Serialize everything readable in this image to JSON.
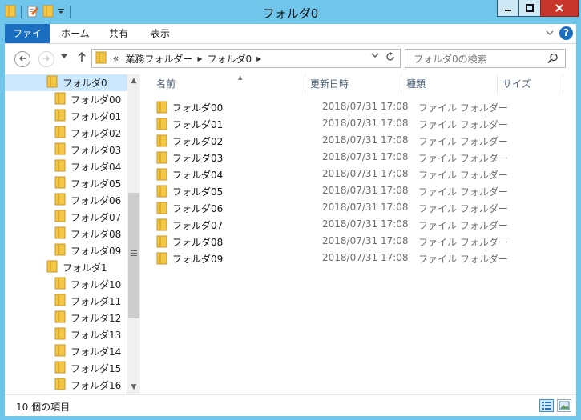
{
  "window": {
    "title": "フォルダ0",
    "colors": {
      "frame": "#6fc5ea",
      "accent": "#1a6fc1",
      "close": "#c7352b",
      "selection": "#cce8ff"
    }
  },
  "ribbon": {
    "tabs": [
      {
        "label": "ファイル"
      },
      {
        "label": "ホーム"
      },
      {
        "label": "共有"
      },
      {
        "label": "表示"
      }
    ]
  },
  "nav": {
    "breadcrumb": [
      "業務フォルダー",
      "フォルダ0"
    ],
    "overflow": "«"
  },
  "search": {
    "placeholder": "フォルダ0の検索"
  },
  "tree": {
    "items": [
      {
        "label": "フォルダ0",
        "level": 0,
        "selected": true
      },
      {
        "label": "フォルダ00",
        "level": 1
      },
      {
        "label": "フォルダ01",
        "level": 1
      },
      {
        "label": "フォルダ02",
        "level": 1
      },
      {
        "label": "フォルダ03",
        "level": 1
      },
      {
        "label": "フォルダ04",
        "level": 1
      },
      {
        "label": "フォルダ05",
        "level": 1
      },
      {
        "label": "フォルダ06",
        "level": 1
      },
      {
        "label": "フォルダ07",
        "level": 1
      },
      {
        "label": "フォルダ08",
        "level": 1
      },
      {
        "label": "フォルダ09",
        "level": 1
      },
      {
        "label": "フォルダ1",
        "level": 0
      },
      {
        "label": "フォルダ10",
        "level": 1
      },
      {
        "label": "フォルダ11",
        "level": 1
      },
      {
        "label": "フォルダ12",
        "level": 1
      },
      {
        "label": "フォルダ13",
        "level": 1
      },
      {
        "label": "フォルダ14",
        "level": 1
      },
      {
        "label": "フォルダ15",
        "level": 1
      },
      {
        "label": "フォルダ16",
        "level": 1
      }
    ]
  },
  "list": {
    "columns": [
      {
        "label": "名前"
      },
      {
        "label": "更新日時"
      },
      {
        "label": "種類"
      },
      {
        "label": "サイズ"
      }
    ],
    "rows": [
      {
        "name": "フォルダ00",
        "date": "2018/07/31 17:08",
        "type": "ファイル フォルダー"
      },
      {
        "name": "フォルダ01",
        "date": "2018/07/31 17:08",
        "type": "ファイル フォルダー"
      },
      {
        "name": "フォルダ02",
        "date": "2018/07/31 17:08",
        "type": "ファイル フォルダー"
      },
      {
        "name": "フォルダ03",
        "date": "2018/07/31 17:08",
        "type": "ファイル フォルダー"
      },
      {
        "name": "フォルダ04",
        "date": "2018/07/31 17:08",
        "type": "ファイル フォルダー"
      },
      {
        "name": "フォルダ05",
        "date": "2018/07/31 17:08",
        "type": "ファイル フォルダー"
      },
      {
        "name": "フォルダ06",
        "date": "2018/07/31 17:08",
        "type": "ファイル フォルダー"
      },
      {
        "name": "フォルダ07",
        "date": "2018/07/31 17:08",
        "type": "ファイル フォルダー"
      },
      {
        "name": "フォルダ08",
        "date": "2018/07/31 17:08",
        "type": "ファイル フォルダー"
      },
      {
        "name": "フォルダ09",
        "date": "2018/07/31 17:08",
        "type": "ファイル フォルダー"
      }
    ]
  },
  "status": {
    "item_count": "10 個の項目"
  }
}
